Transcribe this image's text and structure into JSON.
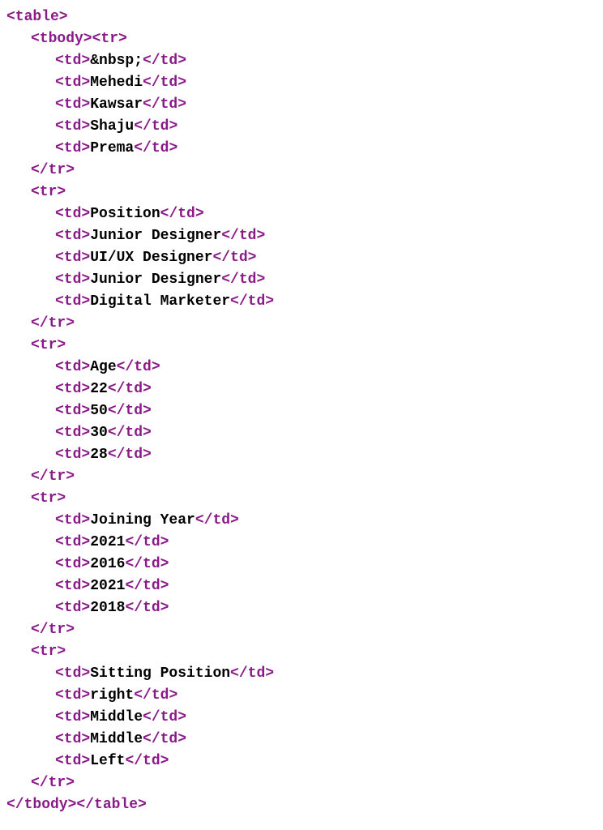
{
  "code": {
    "lines": [
      {
        "indent": 1,
        "segments": [
          {
            "type": "tag",
            "text": "<table>"
          }
        ]
      },
      {
        "indent": 2,
        "segments": [
          {
            "type": "tag",
            "text": "<tbody><tr>"
          }
        ]
      },
      {
        "indent": 3,
        "segments": [
          {
            "type": "tag",
            "text": "<td>"
          },
          {
            "type": "txt",
            "text": "&nbsp;"
          },
          {
            "type": "tag",
            "text": "</td>"
          }
        ]
      },
      {
        "indent": 3,
        "segments": [
          {
            "type": "tag",
            "text": "<td>"
          },
          {
            "type": "txt",
            "text": "Mehedi"
          },
          {
            "type": "tag",
            "text": "</td>"
          }
        ]
      },
      {
        "indent": 3,
        "segments": [
          {
            "type": "tag",
            "text": "<td>"
          },
          {
            "type": "txt",
            "text": "Kawsar"
          },
          {
            "type": "tag",
            "text": "</td>"
          }
        ]
      },
      {
        "indent": 3,
        "segments": [
          {
            "type": "tag",
            "text": "<td>"
          },
          {
            "type": "txt",
            "text": "Shaju"
          },
          {
            "type": "tag",
            "text": "</td>"
          }
        ]
      },
      {
        "indent": 3,
        "segments": [
          {
            "type": "tag",
            "text": "<td>"
          },
          {
            "type": "txt",
            "text": "Prema"
          },
          {
            "type": "tag",
            "text": "</td>"
          }
        ]
      },
      {
        "indent": 2,
        "segments": [
          {
            "type": "tag",
            "text": "</tr>"
          }
        ]
      },
      {
        "indent": 2,
        "segments": [
          {
            "type": "tag",
            "text": "<tr>"
          }
        ]
      },
      {
        "indent": 3,
        "segments": [
          {
            "type": "tag",
            "text": "<td>"
          },
          {
            "type": "txt",
            "text": "Position"
          },
          {
            "type": "tag",
            "text": "</td>"
          }
        ]
      },
      {
        "indent": 3,
        "segments": [
          {
            "type": "tag",
            "text": "<td>"
          },
          {
            "type": "txt",
            "text": "Junior Designer"
          },
          {
            "type": "tag",
            "text": "</td>"
          }
        ]
      },
      {
        "indent": 3,
        "segments": [
          {
            "type": "tag",
            "text": "<td>"
          },
          {
            "type": "txt",
            "text": "UI/UX Designer"
          },
          {
            "type": "tag",
            "text": "</td>"
          }
        ]
      },
      {
        "indent": 3,
        "segments": [
          {
            "type": "tag",
            "text": "<td>"
          },
          {
            "type": "txt",
            "text": "Junior Designer"
          },
          {
            "type": "tag",
            "text": "</td>"
          }
        ]
      },
      {
        "indent": 3,
        "segments": [
          {
            "type": "tag",
            "text": "<td>"
          },
          {
            "type": "txt",
            "text": "Digital Marketer"
          },
          {
            "type": "tag",
            "text": "</td>"
          }
        ]
      },
      {
        "indent": 2,
        "segments": [
          {
            "type": "tag",
            "text": "</tr>"
          }
        ]
      },
      {
        "indent": 2,
        "segments": [
          {
            "type": "tag",
            "text": "<tr>"
          }
        ]
      },
      {
        "indent": 3,
        "segments": [
          {
            "type": "tag",
            "text": "<td>"
          },
          {
            "type": "txt",
            "text": "Age"
          },
          {
            "type": "tag",
            "text": "</td>"
          }
        ]
      },
      {
        "indent": 3,
        "segments": [
          {
            "type": "tag",
            "text": "<td>"
          },
          {
            "type": "txt",
            "text": "22"
          },
          {
            "type": "tag",
            "text": "</td>"
          }
        ]
      },
      {
        "indent": 3,
        "segments": [
          {
            "type": "tag",
            "text": "<td>"
          },
          {
            "type": "txt",
            "text": "50"
          },
          {
            "type": "tag",
            "text": "</td>"
          }
        ]
      },
      {
        "indent": 3,
        "segments": [
          {
            "type": "tag",
            "text": "<td>"
          },
          {
            "type": "txt",
            "text": "30"
          },
          {
            "type": "tag",
            "text": "</td>"
          }
        ]
      },
      {
        "indent": 3,
        "segments": [
          {
            "type": "tag",
            "text": "<td>"
          },
          {
            "type": "txt",
            "text": "28"
          },
          {
            "type": "tag",
            "text": "</td>"
          }
        ]
      },
      {
        "indent": 2,
        "segments": [
          {
            "type": "tag",
            "text": "</tr>"
          }
        ]
      },
      {
        "indent": 2,
        "segments": [
          {
            "type": "tag",
            "text": "<tr>"
          }
        ]
      },
      {
        "indent": 3,
        "segments": [
          {
            "type": "tag",
            "text": "<td>"
          },
          {
            "type": "txt",
            "text": "Joining Year"
          },
          {
            "type": "tag",
            "text": "</td>"
          }
        ]
      },
      {
        "indent": 3,
        "segments": [
          {
            "type": "tag",
            "text": "<td>"
          },
          {
            "type": "txt",
            "text": "2021"
          },
          {
            "type": "tag",
            "text": "</td>"
          }
        ]
      },
      {
        "indent": 3,
        "segments": [
          {
            "type": "tag",
            "text": "<td>"
          },
          {
            "type": "txt",
            "text": "2016"
          },
          {
            "type": "tag",
            "text": "</td>"
          }
        ]
      },
      {
        "indent": 3,
        "segments": [
          {
            "type": "tag",
            "text": "<td>"
          },
          {
            "type": "txt",
            "text": "2021"
          },
          {
            "type": "tag",
            "text": "</td>"
          }
        ]
      },
      {
        "indent": 3,
        "segments": [
          {
            "type": "tag",
            "text": "<td>"
          },
          {
            "type": "txt",
            "text": "2018"
          },
          {
            "type": "tag",
            "text": "</td>"
          }
        ]
      },
      {
        "indent": 2,
        "segments": [
          {
            "type": "tag",
            "text": "</tr>"
          }
        ]
      },
      {
        "indent": 2,
        "segments": [
          {
            "type": "tag",
            "text": "<tr>"
          }
        ]
      },
      {
        "indent": 3,
        "segments": [
          {
            "type": "tag",
            "text": "<td>"
          },
          {
            "type": "txt",
            "text": "Sitting Position"
          },
          {
            "type": "tag",
            "text": "</td>"
          }
        ]
      },
      {
        "indent": 3,
        "segments": [
          {
            "type": "tag",
            "text": "<td>"
          },
          {
            "type": "txt",
            "text": "right"
          },
          {
            "type": "tag",
            "text": "</td>"
          }
        ]
      },
      {
        "indent": 3,
        "segments": [
          {
            "type": "tag",
            "text": "<td>"
          },
          {
            "type": "txt",
            "text": "Middle"
          },
          {
            "type": "tag",
            "text": "</td>"
          }
        ]
      },
      {
        "indent": 3,
        "segments": [
          {
            "type": "tag",
            "text": "<td>"
          },
          {
            "type": "txt",
            "text": "Middle"
          },
          {
            "type": "tag",
            "text": "</td>"
          }
        ]
      },
      {
        "indent": 3,
        "segments": [
          {
            "type": "tag",
            "text": "<td>"
          },
          {
            "type": "txt",
            "text": "Left"
          },
          {
            "type": "tag",
            "text": "</td>"
          }
        ]
      },
      {
        "indent": 2,
        "segments": [
          {
            "type": "tag",
            "text": "</tr>"
          }
        ]
      },
      {
        "indent": 1,
        "segments": [
          {
            "type": "tag",
            "text": "</tbody></table>"
          }
        ]
      }
    ]
  }
}
